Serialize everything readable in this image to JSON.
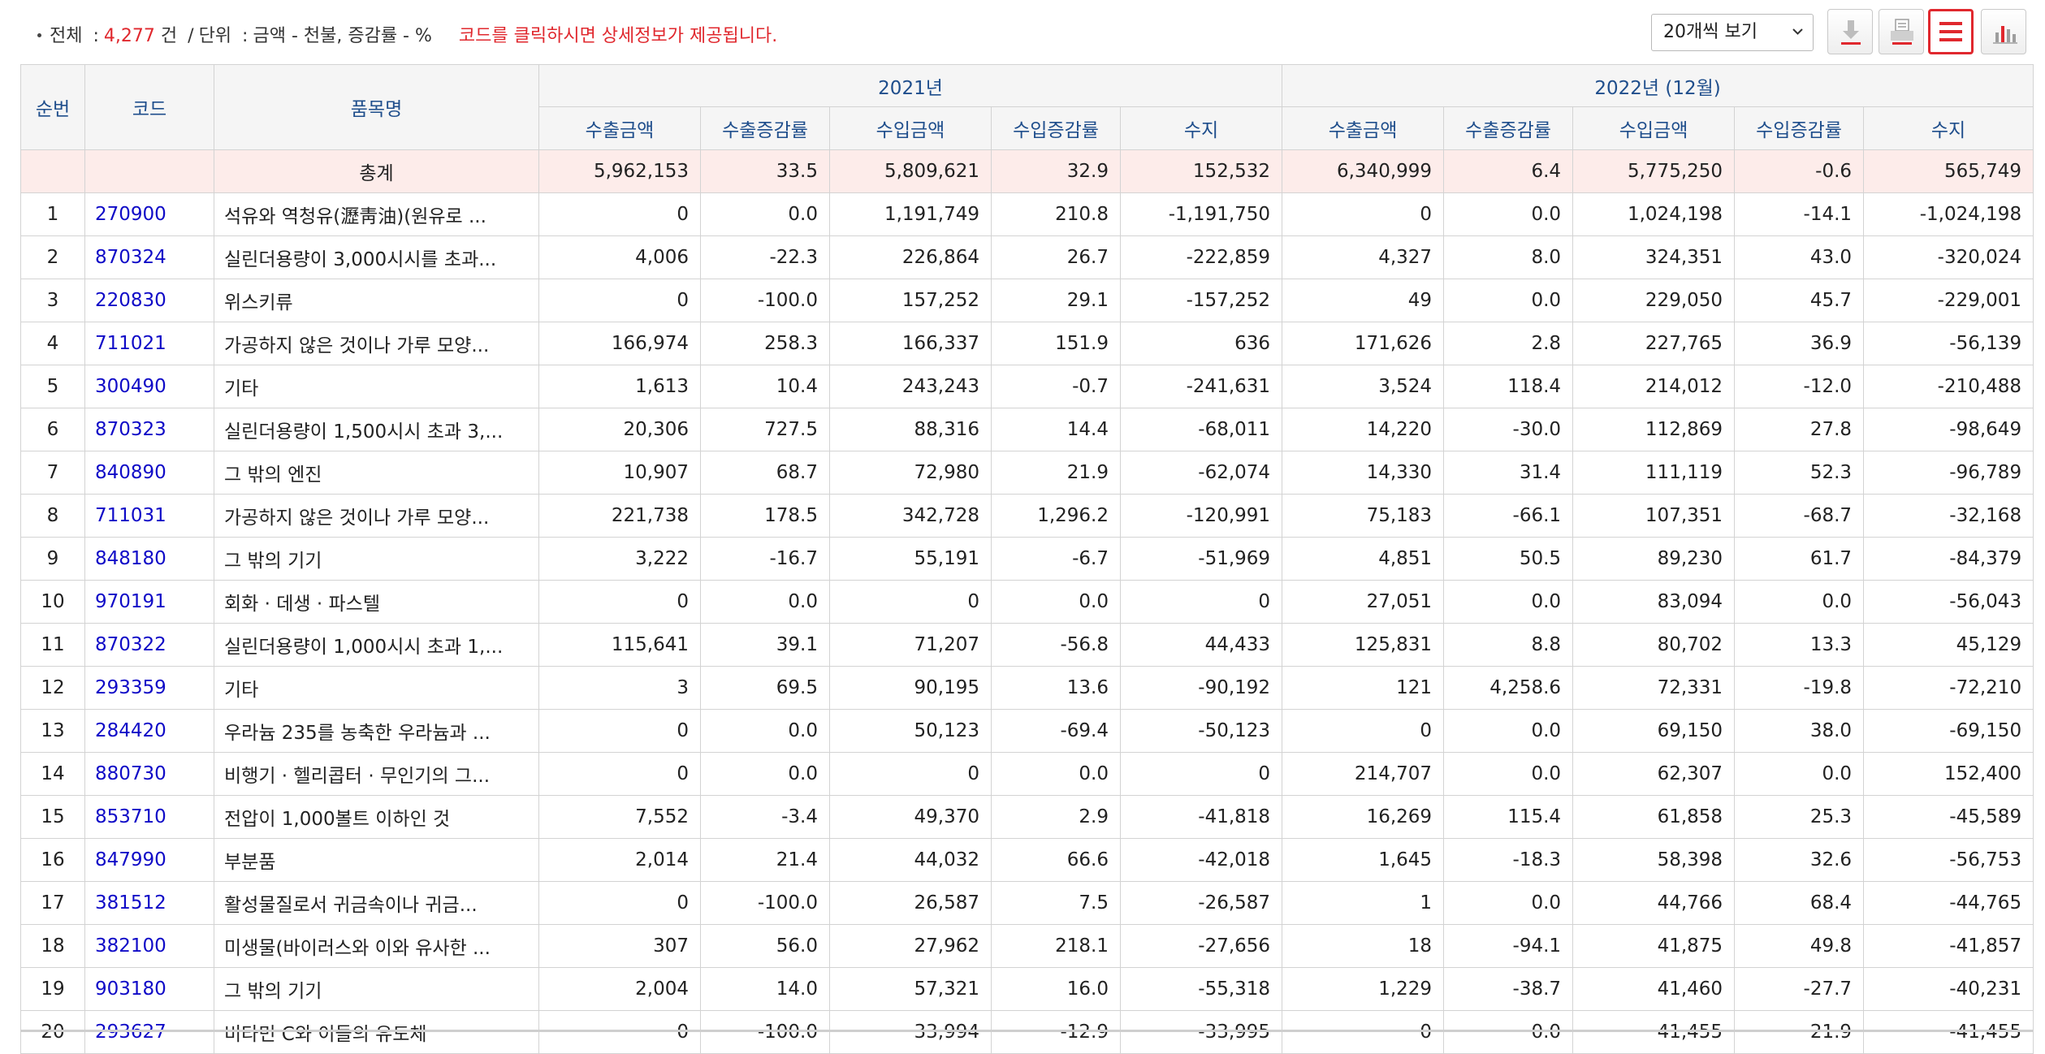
{
  "summary": {
    "total_label": "전체",
    "colon": ":",
    "total_count": "4,277",
    "count_unit": "건",
    "slash": "/",
    "unit_label": "단위",
    "unit_text": "금액 - 천불, 증감률 - %",
    "notice": "코드를 클릭하시면 상세정보가 제공됩니다."
  },
  "toolbar": {
    "page_size": "20개씩 보기",
    "buttons": [
      "download-icon",
      "print-icon",
      "list-view-icon",
      "chart-view-icon"
    ],
    "accent": "#e0282e"
  },
  "table": {
    "headers": {
      "no": "순번",
      "code": "코드",
      "name": "품목명",
      "period1": "2021년",
      "period2": "2022년 (12월)",
      "sub": [
        "수출금액",
        "수출증감률",
        "수입금액",
        "수입증감률",
        "수지"
      ]
    },
    "total": {
      "name": "총계",
      "values": [
        "5,962,153",
        "33.5",
        "5,809,621",
        "32.9",
        "152,532",
        "6,340,999",
        "6.4",
        "5,775,250",
        "-0.6",
        "565,749"
      ]
    },
    "rows": [
      {
        "no": "1",
        "code": "270900",
        "name": "석유와 역청유(瀝靑油)(원유로 ...",
        "values": [
          "0",
          "0.0",
          "1,191,749",
          "210.8",
          "-1,191,750",
          "0",
          "0.0",
          "1,024,198",
          "-14.1",
          "-1,024,198"
        ]
      },
      {
        "no": "2",
        "code": "870324",
        "name": "실린더용량이 3,000시시를 초과...",
        "values": [
          "4,006",
          "-22.3",
          "226,864",
          "26.7",
          "-222,859",
          "4,327",
          "8.0",
          "324,351",
          "43.0",
          "-320,024"
        ]
      },
      {
        "no": "3",
        "code": "220830",
        "name": "위스키류",
        "values": [
          "0",
          "-100.0",
          "157,252",
          "29.1",
          "-157,252",
          "49",
          "0.0",
          "229,050",
          "45.7",
          "-229,001"
        ]
      },
      {
        "no": "4",
        "code": "711021",
        "name": "가공하지 않은 것이나 가루 모양...",
        "values": [
          "166,974",
          "258.3",
          "166,337",
          "151.9",
          "636",
          "171,626",
          "2.8",
          "227,765",
          "36.9",
          "-56,139"
        ]
      },
      {
        "no": "5",
        "code": "300490",
        "name": "기타",
        "values": [
          "1,613",
          "10.4",
          "243,243",
          "-0.7",
          "-241,631",
          "3,524",
          "118.4",
          "214,012",
          "-12.0",
          "-210,488"
        ]
      },
      {
        "no": "6",
        "code": "870323",
        "name": "실린더용량이 1,500시시 초과 3,...",
        "values": [
          "20,306",
          "727.5",
          "88,316",
          "14.4",
          "-68,011",
          "14,220",
          "-30.0",
          "112,869",
          "27.8",
          "-98,649"
        ]
      },
      {
        "no": "7",
        "code": "840890",
        "name": "그 밖의 엔진",
        "values": [
          "10,907",
          "68.7",
          "72,980",
          "21.9",
          "-62,074",
          "14,330",
          "31.4",
          "111,119",
          "52.3",
          "-96,789"
        ]
      },
      {
        "no": "8",
        "code": "711031",
        "name": "가공하지 않은 것이나 가루 모양...",
        "values": [
          "221,738",
          "178.5",
          "342,728",
          "1,296.2",
          "-120,991",
          "75,183",
          "-66.1",
          "107,351",
          "-68.7",
          "-32,168"
        ]
      },
      {
        "no": "9",
        "code": "848180",
        "name": "그 밖의 기기",
        "values": [
          "3,222",
          "-16.7",
          "55,191",
          "-6.7",
          "-51,969",
          "4,851",
          "50.5",
          "89,230",
          "61.7",
          "-84,379"
        ]
      },
      {
        "no": "10",
        "code": "970191",
        "name": "회화 · 데생 · 파스텔",
        "values": [
          "0",
          "0.0",
          "0",
          "0.0",
          "0",
          "27,051",
          "0.0",
          "83,094",
          "0.0",
          "-56,043"
        ]
      },
      {
        "no": "11",
        "code": "870322",
        "name": "실린더용량이 1,000시시 초과 1,...",
        "values": [
          "115,641",
          "39.1",
          "71,207",
          "-56.8",
          "44,433",
          "125,831",
          "8.8",
          "80,702",
          "13.3",
          "45,129"
        ]
      },
      {
        "no": "12",
        "code": "293359",
        "name": "기타",
        "values": [
          "3",
          "69.5",
          "90,195",
          "13.6",
          "-90,192",
          "121",
          "4,258.6",
          "72,331",
          "-19.8",
          "-72,210"
        ]
      },
      {
        "no": "13",
        "code": "284420",
        "name": "우라늄 235를 농축한 우라늄과 ...",
        "values": [
          "0",
          "0.0",
          "50,123",
          "-69.4",
          "-50,123",
          "0",
          "0.0",
          "69,150",
          "38.0",
          "-69,150"
        ]
      },
      {
        "no": "14",
        "code": "880730",
        "name": "비행기 · 헬리콥터 · 무인기의 그...",
        "values": [
          "0",
          "0.0",
          "0",
          "0.0",
          "0",
          "214,707",
          "0.0",
          "62,307",
          "0.0",
          "152,400"
        ]
      },
      {
        "no": "15",
        "code": "853710",
        "name": "전압이 1,000볼트 이하인 것",
        "values": [
          "7,552",
          "-3.4",
          "49,370",
          "2.9",
          "-41,818",
          "16,269",
          "115.4",
          "61,858",
          "25.3",
          "-45,589"
        ]
      },
      {
        "no": "16",
        "code": "847990",
        "name": "부분품",
        "values": [
          "2,014",
          "21.4",
          "44,032",
          "66.6",
          "-42,018",
          "1,645",
          "-18.3",
          "58,398",
          "32.6",
          "-56,753"
        ]
      },
      {
        "no": "17",
        "code": "381512",
        "name": "활성물질로서 귀금속이나 귀금...",
        "values": [
          "0",
          "-100.0",
          "26,587",
          "7.5",
          "-26,587",
          "1",
          "0.0",
          "44,766",
          "68.4",
          "-44,765"
        ]
      },
      {
        "no": "18",
        "code": "382100",
        "name": "미생물(바이러스와 이와 유사한 ...",
        "values": [
          "307",
          "56.0",
          "27,962",
          "218.1",
          "-27,656",
          "18",
          "-94.1",
          "41,875",
          "49.8",
          "-41,857"
        ]
      },
      {
        "no": "19",
        "code": "903180",
        "name": "그 밖의 기기",
        "values": [
          "2,004",
          "14.0",
          "57,321",
          "16.0",
          "-55,318",
          "1,229",
          "-38.7",
          "41,460",
          "-27.7",
          "-40,231"
        ]
      },
      {
        "no": "20",
        "code": "293627",
        "name": "비타민 C와 이들의 유도체",
        "values": [
          "0",
          "-100.0",
          "33,994",
          "-12.9",
          "-33,995",
          "0",
          "0.0",
          "41,455",
          "21.9",
          "-41,455"
        ]
      }
    ]
  }
}
